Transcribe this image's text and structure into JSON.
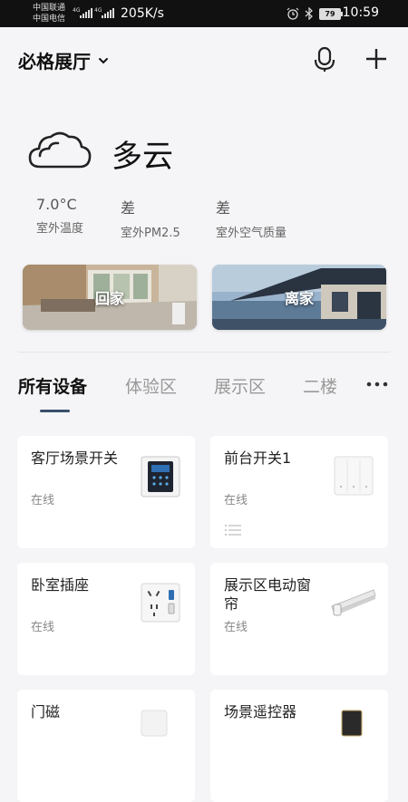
{
  "status_bar": {
    "carrier_1": "中国联通",
    "carrier_2": "中国电信",
    "net_1": "4G",
    "net_2": "4G",
    "speed": "205K/s",
    "battery": "79",
    "time": "10:59"
  },
  "header": {
    "home_name": "必格展厅"
  },
  "weather": {
    "condition": "多云",
    "stats": [
      {
        "value": "7.0°C",
        "label": "室外温度"
      },
      {
        "value": "差",
        "label": "室外PM2.5"
      },
      {
        "value": "差",
        "label": "室外空气质量"
      }
    ]
  },
  "scenes": [
    {
      "label": "回家"
    },
    {
      "label": "离家"
    }
  ],
  "tabs": [
    {
      "label": "所有设备",
      "active": true
    },
    {
      "label": "体验区"
    },
    {
      "label": "展示区"
    },
    {
      "label": "二楼"
    }
  ],
  "devices": [
    {
      "name": "客厅场景开关",
      "status": "在线"
    },
    {
      "name": "前台开关1",
      "status": "在线"
    },
    {
      "name": "卧室插座",
      "status": "在线"
    },
    {
      "name": "展示区电动窗帘",
      "status": "在线"
    },
    {
      "name": "门磁",
      "status": ""
    },
    {
      "name": "场景遥控器",
      "status": ""
    }
  ],
  "colors": {
    "background": "#f5f5f7",
    "tab_indicator": "#3a4f6c",
    "status_bar": "#111111"
  }
}
